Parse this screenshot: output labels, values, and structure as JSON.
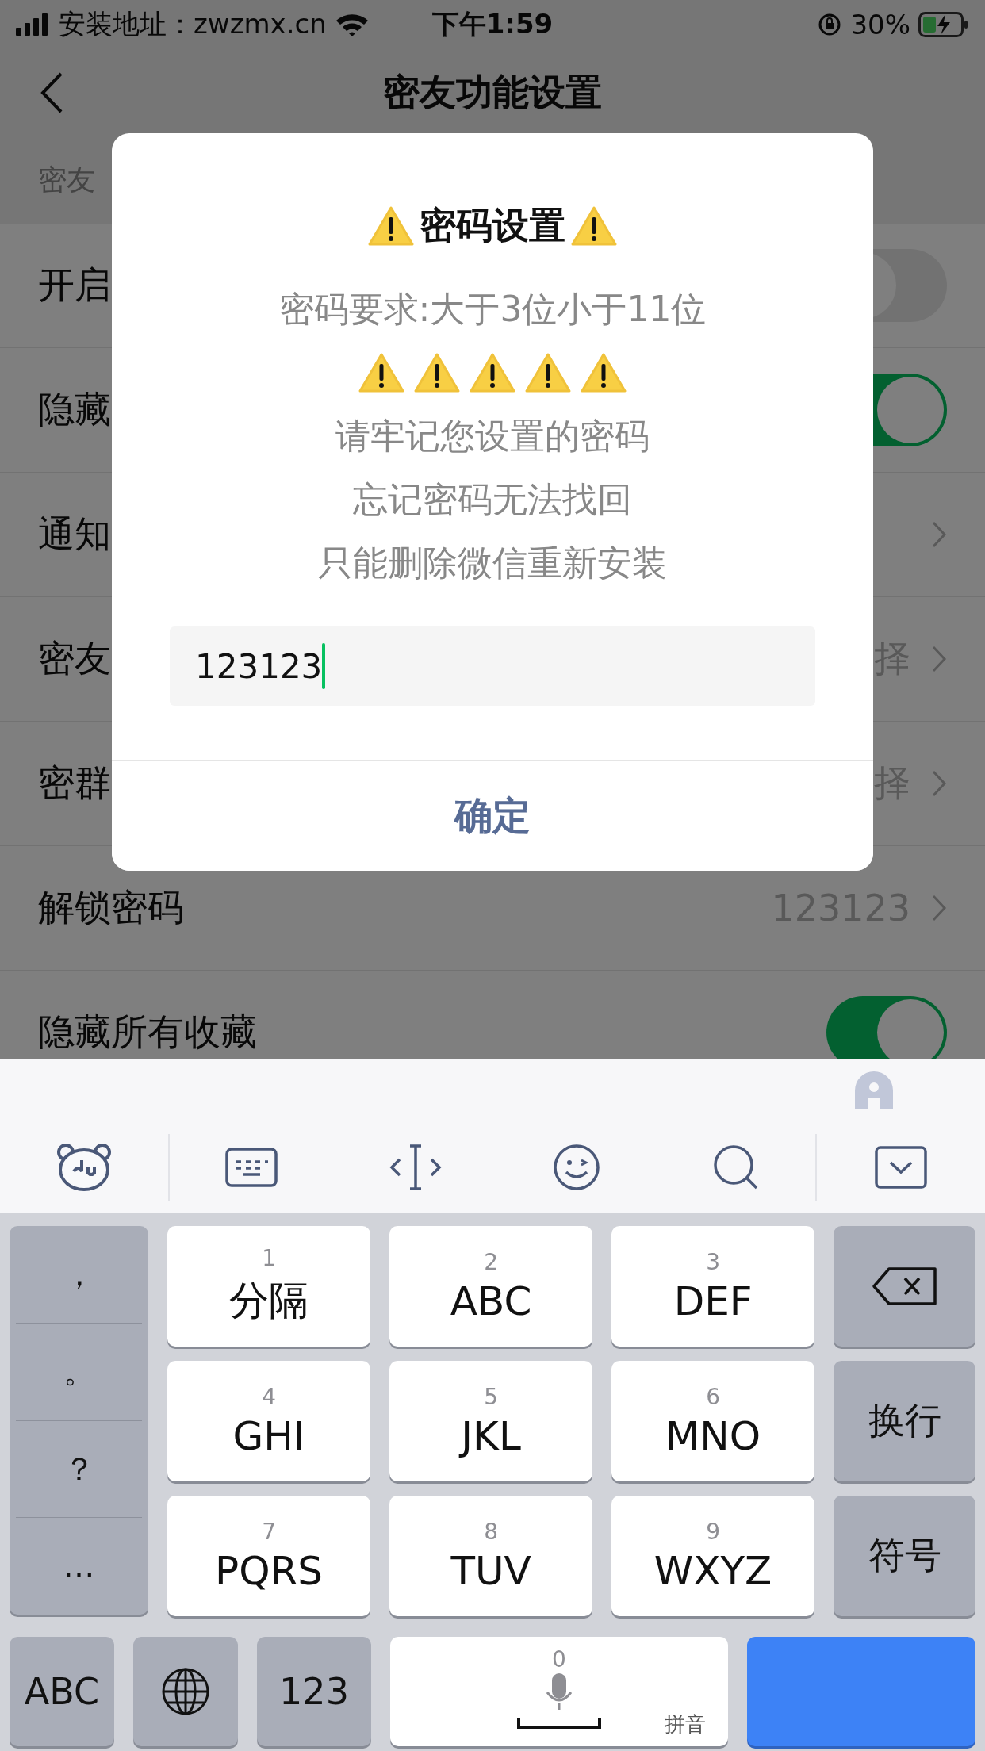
{
  "status_bar": {
    "carrier": "安装地址：zwzmx.cn",
    "time": "下午1:59",
    "battery": "30%"
  },
  "nav": {
    "title": "密友功能设置"
  },
  "section_header": "密友",
  "rows": [
    {
      "kind": "toggle",
      "label": "开启",
      "on": false
    },
    {
      "kind": "toggle",
      "label": "隐藏",
      "on": true
    },
    {
      "kind": "link",
      "label": "通知"
    },
    {
      "kind": "link",
      "label": "密友",
      "value": "择"
    },
    {
      "kind": "link",
      "label": "密群",
      "value": "择"
    },
    {
      "kind": "link",
      "label": "解锁密码",
      "value": "123123"
    },
    {
      "kind": "toggle",
      "label": "隐藏所有收藏",
      "on": true
    }
  ],
  "dialog": {
    "title": "密码设置",
    "requirement": "密码要求:大于3位小于11位",
    "lines": [
      "请牢记您设置的密码",
      "忘记密码无法找回",
      "只能删除微信重新安装"
    ],
    "input_value": "123123",
    "confirm": "确定"
  },
  "keyboard": {
    "punctuation": [
      "，",
      "。",
      "？",
      "…"
    ],
    "keys": [
      {
        "digit": "1",
        "label": "分隔"
      },
      {
        "digit": "2",
        "label": "ABC"
      },
      {
        "digit": "3",
        "label": "DEF"
      },
      {
        "digit": "4",
        "label": "GHI"
      },
      {
        "digit": "5",
        "label": "JKL"
      },
      {
        "digit": "6",
        "label": "MNO"
      },
      {
        "digit": "7",
        "label": "PQRS"
      },
      {
        "digit": "8",
        "label": "TUV"
      },
      {
        "digit": "9",
        "label": "WXYZ"
      }
    ],
    "newline": "换行",
    "symbols": "符号",
    "abc": "ABC",
    "numbers": "123",
    "space_digit": "0",
    "space_label": "拼音"
  }
}
